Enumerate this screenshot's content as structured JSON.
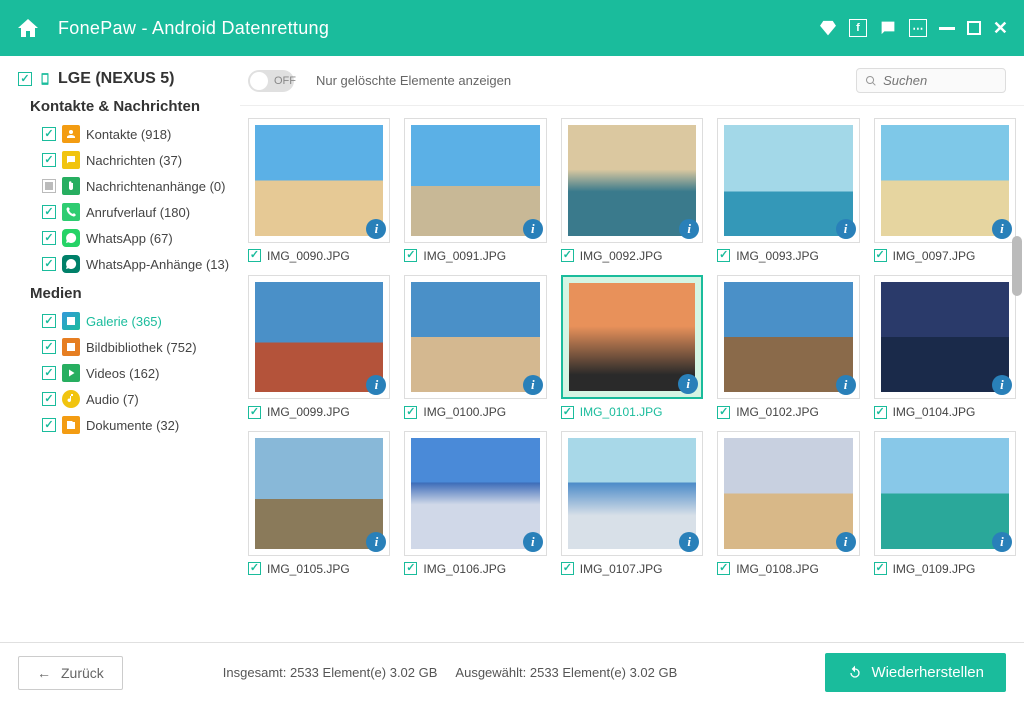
{
  "header": {
    "title": "FonePaw - Android Datenrettung"
  },
  "device": {
    "name": "LGE (NEXUS 5)"
  },
  "section_contacts": "Kontakte & Nachrichten",
  "section_media": "Medien",
  "cats_contacts": [
    {
      "label": "Kontakte (918)",
      "icon": "contacts"
    },
    {
      "label": "Nachrichten (37)",
      "icon": "msg"
    },
    {
      "label": "Nachrichtenanhänge (0)",
      "icon": "attach",
      "unchecked": true
    },
    {
      "label": "Anrufverlauf (180)",
      "icon": "call"
    },
    {
      "label": "WhatsApp (67)",
      "icon": "wa"
    },
    {
      "label": "WhatsApp-Anhänge (13)",
      "icon": "waatt"
    }
  ],
  "cats_media": [
    {
      "label": "Galerie (365)",
      "icon": "gallery",
      "active": true
    },
    {
      "label": "Bildbibliothek (752)",
      "icon": "lib"
    },
    {
      "label": "Videos (162)",
      "icon": "video"
    },
    {
      "label": "Audio (7)",
      "icon": "audio"
    },
    {
      "label": "Dokumente (32)",
      "icon": "docs"
    }
  ],
  "toolbar": {
    "toggle_state": "OFF",
    "toggle_text": "Nur gelöschte Elemente anzeigen",
    "search_placeholder": "Suchen"
  },
  "images": [
    {
      "name": "IMG_0090.JPG",
      "p": 0
    },
    {
      "name": "IMG_0091.JPG",
      "p": 1
    },
    {
      "name": "IMG_0092.JPG",
      "p": 2
    },
    {
      "name": "IMG_0093.JPG",
      "p": 3
    },
    {
      "name": "IMG_0097.JPG",
      "p": 4
    },
    {
      "name": "IMG_0099.JPG",
      "p": 5
    },
    {
      "name": "IMG_0100.JPG",
      "p": 6
    },
    {
      "name": "IMG_0101.JPG",
      "p": 7,
      "selected": true
    },
    {
      "name": "IMG_0102.JPG",
      "p": 8
    },
    {
      "name": "IMG_0104.JPG",
      "p": 9
    },
    {
      "name": "IMG_0105.JPG",
      "p": 10
    },
    {
      "name": "IMG_0106.JPG",
      "p": 11
    },
    {
      "name": "IMG_0107.JPG",
      "p": 12
    },
    {
      "name": "IMG_0108.JPG",
      "p": 13
    },
    {
      "name": "IMG_0109.JPG",
      "p": 14
    }
  ],
  "footer": {
    "back": "Zurück",
    "total_label": "Insgesamt: 2533 Element(e) 3.02 GB",
    "selected_label": "Ausgewählt: 2533 Element(e) 3.02 GB",
    "recover": "Wiederherstellen"
  }
}
